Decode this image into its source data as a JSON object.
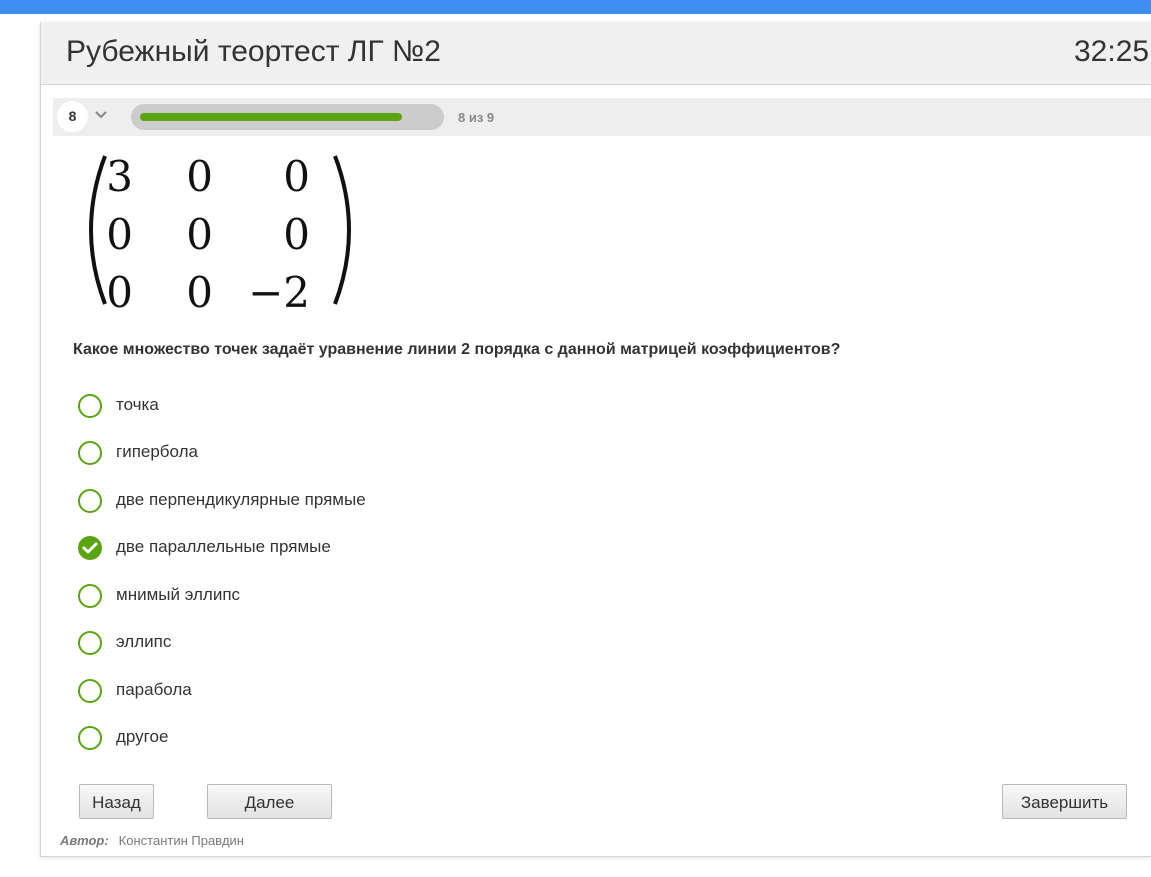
{
  "colors": {
    "topbar": "#3f8ef3",
    "accent_green": "#5aa312",
    "header_bg": "#f0f0f0"
  },
  "header": {
    "title": "Рубежный теортест ЛГ №2",
    "timer": "32:25"
  },
  "navigator": {
    "current_question": "8",
    "dropdown_icon": "chevron-down-icon",
    "progress_fraction": 0.889,
    "progress_text": "8 из 9"
  },
  "matrix": {
    "rows": [
      [
        "3",
        "0",
        "0"
      ],
      [
        "0",
        "0",
        "0"
      ],
      [
        "0",
        "0",
        "−2"
      ]
    ]
  },
  "question": {
    "text": "Какое множество точек задаёт уравнение линии 2 порядка с данной матрицей коэффициентов?",
    "options": [
      {
        "label": "точка",
        "checked": false
      },
      {
        "label": "гипербола",
        "checked": false
      },
      {
        "label": "две перпендикулярные прямые",
        "checked": false
      },
      {
        "label": "две параллельные прямые",
        "checked": true
      },
      {
        "label": "мнимый эллипс",
        "checked": false
      },
      {
        "label": "эллипс",
        "checked": false
      },
      {
        "label": "парабола",
        "checked": false
      },
      {
        "label": "другое",
        "checked": false
      }
    ]
  },
  "buttons": {
    "back": "Назад",
    "next": "Далее",
    "finish": "Завершить"
  },
  "author": {
    "label": "Автор:",
    "name": "Константин Правдин"
  }
}
